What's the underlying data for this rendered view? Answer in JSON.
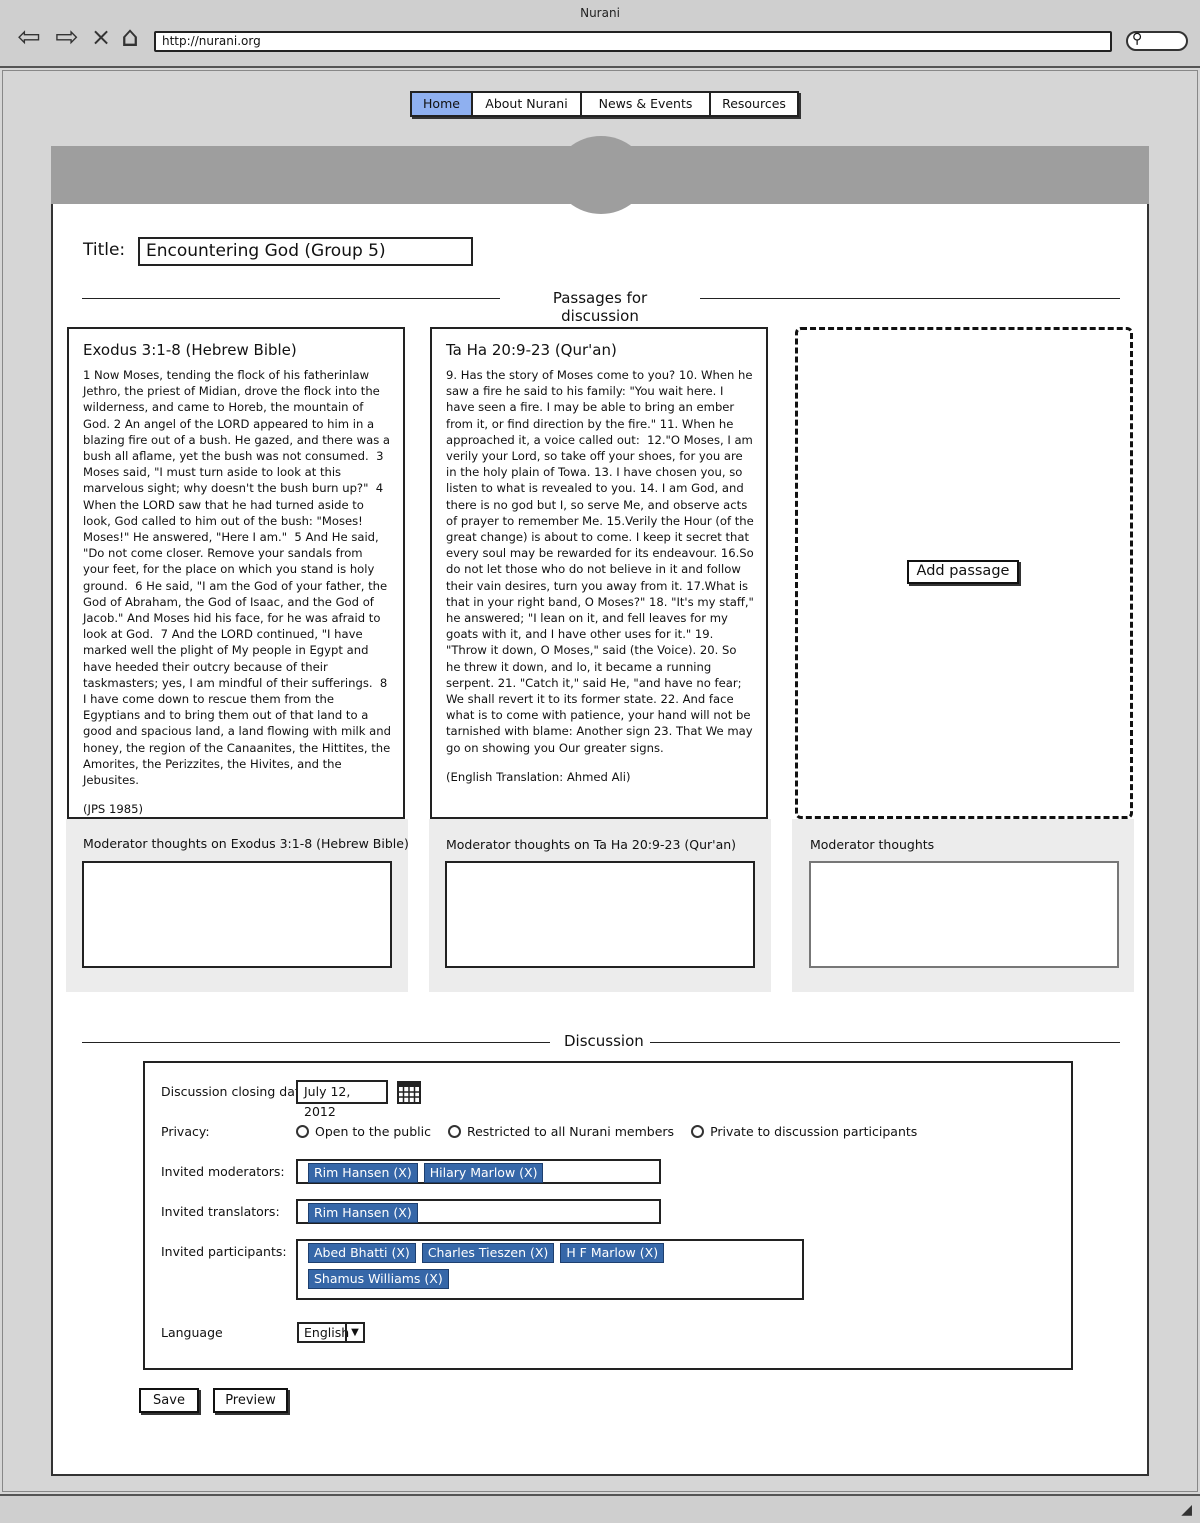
{
  "browser": {
    "window_title": "Nurani",
    "url": "http://nurani.org",
    "back_glyph": "⇦",
    "forward_glyph": "⇨",
    "stop_glyph": "×",
    "home_glyph": "⌂",
    "search_glyph": "⚲"
  },
  "nav": {
    "tabs": [
      "Home",
      "About Nurani",
      "News & Events",
      "Resources"
    ],
    "active_tab": "Home"
  },
  "form": {
    "title_label": "Title:",
    "title_value": "Encountering God (Group 5)"
  },
  "passages_section": {
    "heading": "Passages for discussion",
    "passages": [
      {
        "title": "Exodus 3:1-8 (Hebrew Bible)",
        "text": "1 Now Moses, tending the flock of his fatherinlaw Jethro, the priest of Midian, drove the flock into the wilderness, and came to Horeb, the mountain of God. 2 An angel of the LORD appeared to him in a blazing fire out of a bush. He gazed, and there was a bush all aflame, yet the bush was not consumed.  3 Moses said, \"I must turn aside to look at this marvelous sight; why doesn't the bush burn up?\"  4 When the LORD saw that he had turned aside to look, God called to him out of the bush: \"Moses! Moses!\" He answered, \"Here I am.\"  5 And He said, \"Do not come closer. Remove your sandals from your feet, for the place on which you stand is holy ground.  6 He said, \"I am the God of your father, the God of Abraham, the God of Isaac, and the God of Jacob.\" And Moses hid his face, for he was afraid to look at God.  7 And the LORD continued, \"I have marked well the plight of My people in Egypt and have heeded their outcry because of their taskmasters; yes, I am mindful of their sufferings.  8 I have come down to rescue them from the Egyptians and to bring them out of that land to a good and spacious land, a land flowing with milk and honey, the region of the Canaanites, the Hittites, the Amorites, the Perizzites, the Hivites, and the Jebusites.",
        "credit": "(JPS 1985)",
        "moderator_label": "Moderator thoughts on Exodus 3:1-8 (Hebrew Bible)"
      },
      {
        "title": "Ta Ha 20:9-23 (Qur'an)",
        "text": "9. Has the story of Moses come to you? 10. When he saw a fire he said to his family: \"You wait here. I have seen a fire. I may be able to bring an ember from it, or find direction by the fire.\" 11. When he approached it, a voice called out:  12.\"O Moses, I am verily your Lord, so take off your shoes, for you are in the holy plain of Towa. 13. I have chosen you, so listen to what is revealed to you. 14. I am God, and there is no god but I, so serve Me, and observe acts of prayer to remember Me. 15.Verily the Hour (of the great change) is about to come. I keep it secret that every soul may be rewarded for its endeavour. 16.So do not let those who do not believe in it and follow their vain desires, turn you away from it. 17.What is that in your right band, O Moses?\" 18. \"It's my staff,\" he answered; \"I lean on it, and fell leaves for my goats with it, and I have other uses for it.\" 19. \"Throw it down, O Moses,\" said (the Voice). 20. So he threw it down, and lo, it became a running serpent. 21. \"Catch it,\" said He, \"and have no fear; We shall revert it to its former state. 22. And face what is to come with patience, your hand will not be tarnished with blame: Another sign 23. That We may go on showing you Our greater signs.",
        "credit": " (English Translation: Ahmed Ali)",
        "moderator_label": "Moderator thoughts on Ta Ha 20:9-23 (Qur'an)"
      }
    ],
    "add_passage_label": "Add passage",
    "empty_moderator_label": "Moderator thoughts"
  },
  "discussion": {
    "heading": "Discussion",
    "closing_date_label": "Discussion closing date:",
    "closing_date_value": "July 12, 2012",
    "privacy_label": "Privacy:",
    "privacy_options": [
      "Open to the public",
      "Restricted to all Nurani members",
      "Private to discussion participants"
    ],
    "moderators_label": "Invited moderators:",
    "moderators": [
      "Rim Hansen (X)",
      "Hilary Marlow (X)"
    ],
    "translators_label": "Invited translators:",
    "translators": [
      "Rim Hansen (X)"
    ],
    "participants_label": "Invited participants:",
    "participants": [
      "Abed Bhatti (X)",
      "Charles Tieszen (X)",
      "H F Marlow (X)",
      "Shamus Williams (X)"
    ],
    "language_label": "Language",
    "language_value": "English"
  },
  "actions": {
    "save_label": "Save",
    "preview_label": "Preview"
  },
  "colors": {
    "active_tab": "#8fb0f0",
    "tag_bg": "#3667a8",
    "banner": "#9e9e9e"
  },
  "icons": [
    "back-arrow-icon",
    "forward-arrow-icon",
    "stop-icon",
    "home-icon",
    "search-icon",
    "calendar-icon",
    "dropdown-arrow-icon",
    "resize-grip-icon"
  ]
}
